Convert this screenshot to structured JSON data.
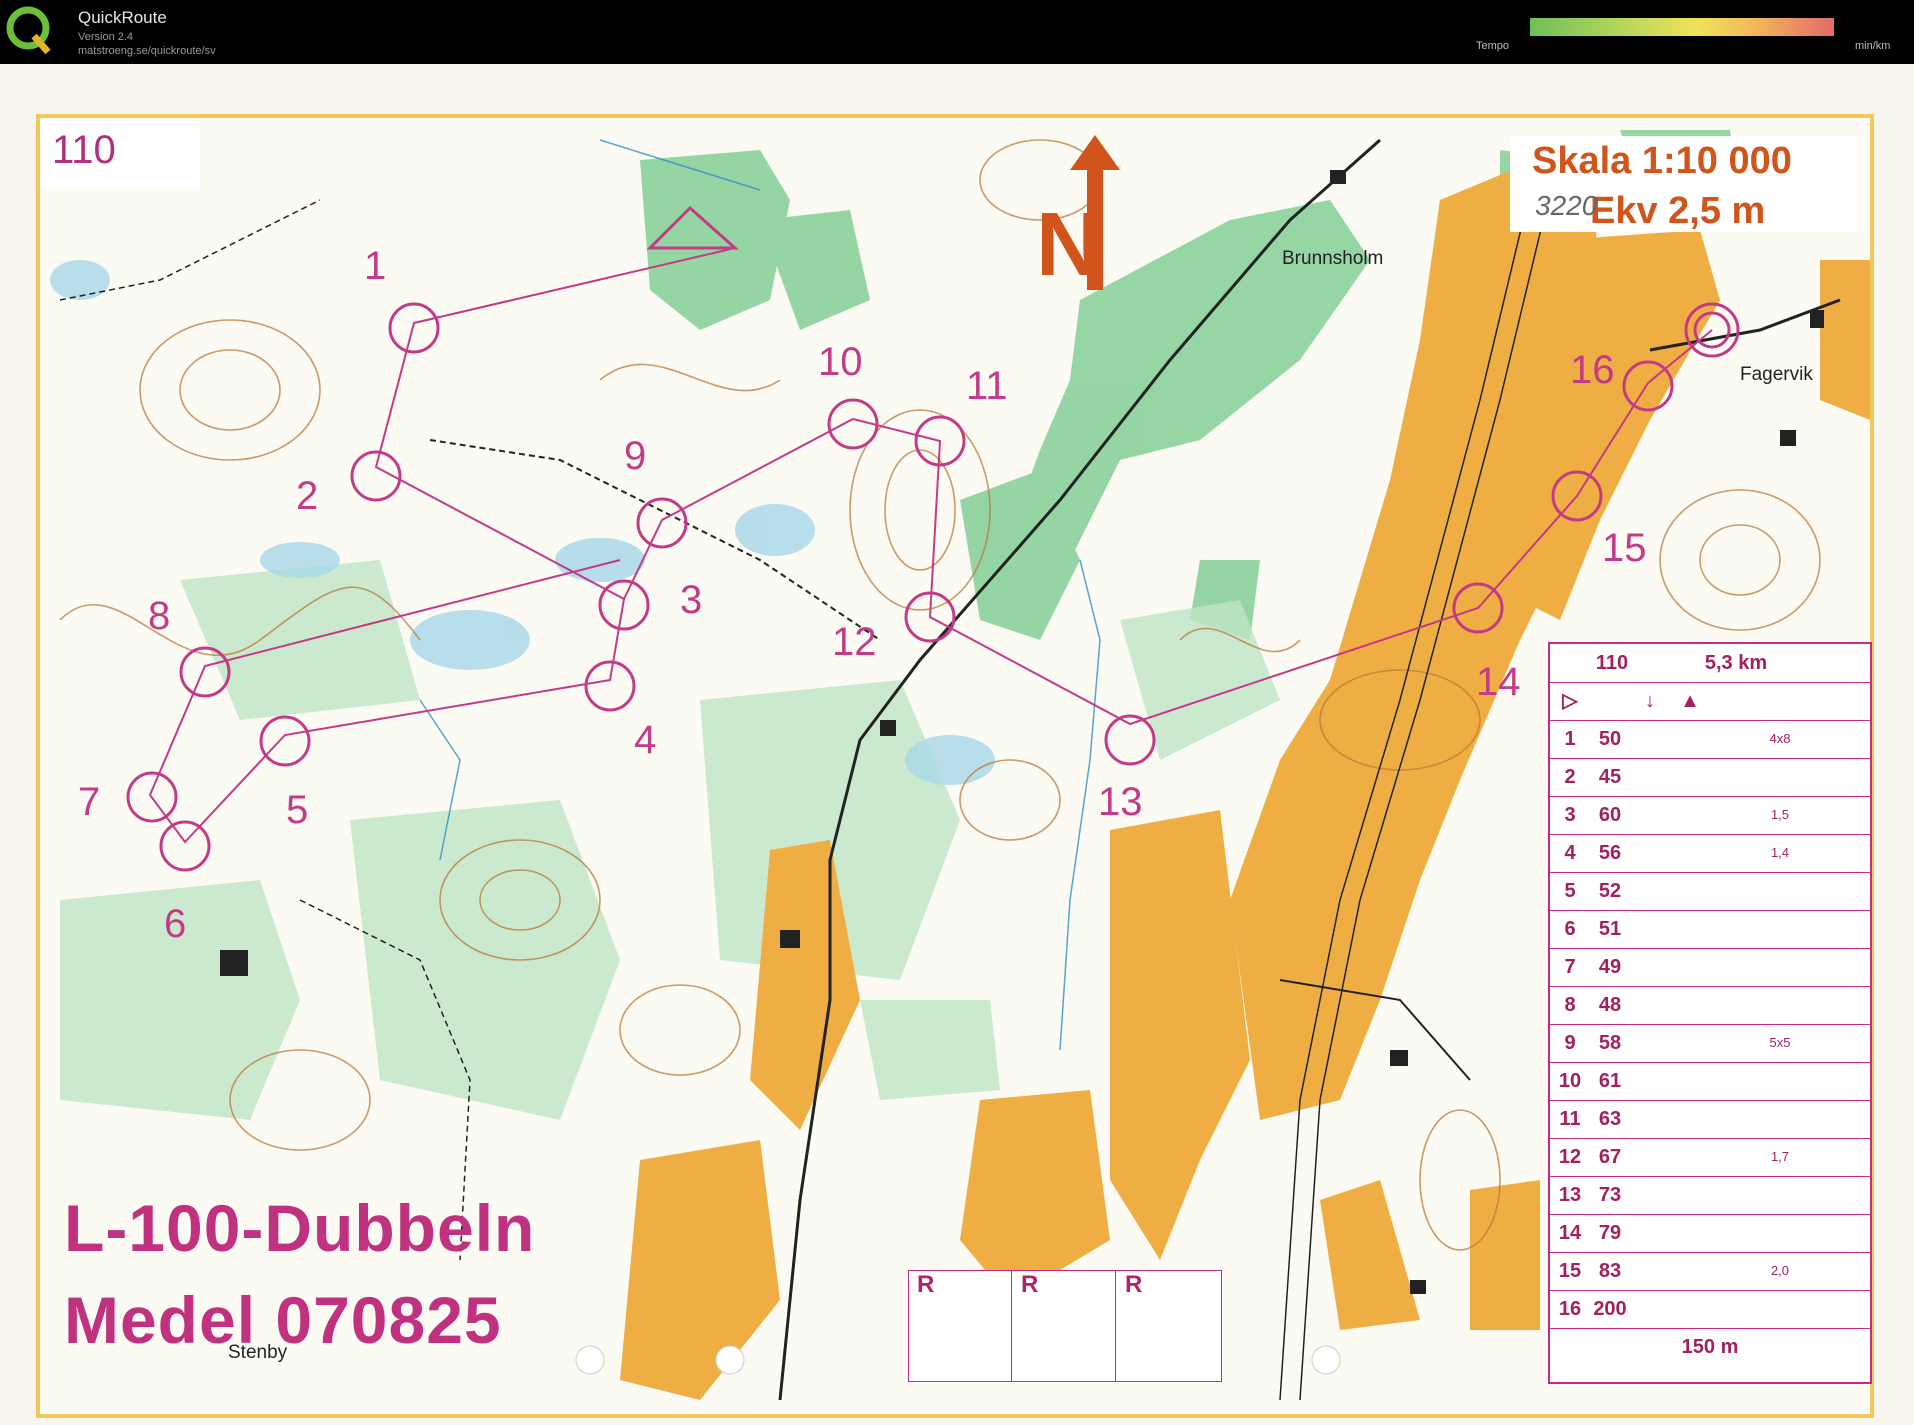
{
  "app": {
    "name": "QuickRoute",
    "version": "Version 2.4",
    "url": "matstroeng.se/quickroute/sv",
    "tempo_label": "Tempo",
    "tempo_unit": "min/km"
  },
  "map": {
    "course_number": "110",
    "scale_text": "Skala 1:10 000",
    "contour_text": "Ekv 2,5 m",
    "handwriting": "3220",
    "place_names": [
      "Brunnsholm",
      "Fagervik",
      "Stenby"
    ],
    "event_title": "L-100-Dubbeln",
    "event_subtitle": "Medel 070825",
    "north_letter": "N",
    "control_labels": [
      "1",
      "2",
      "3",
      "4",
      "5",
      "6",
      "7",
      "8",
      "9",
      "10",
      "11",
      "12",
      "13",
      "14",
      "15",
      "16"
    ],
    "colors": {
      "course": "#c33a86",
      "open_land": "#f0b24a",
      "forest_green": "#7ec88f",
      "contours": "#b97a3a"
    }
  },
  "description_table": {
    "header_course": "110",
    "header_length": "5,3 km",
    "rows": [
      {
        "num": "1",
        "code": "50",
        "extra": "4x8"
      },
      {
        "num": "2",
        "code": "45",
        "extra": ""
      },
      {
        "num": "3",
        "code": "60",
        "extra": "1,5"
      },
      {
        "num": "4",
        "code": "56",
        "extra": "1,4"
      },
      {
        "num": "5",
        "code": "52",
        "extra": ""
      },
      {
        "num": "6",
        "code": "51",
        "extra": ""
      },
      {
        "num": "7",
        "code": "49",
        "extra": ""
      },
      {
        "num": "8",
        "code": "48",
        "extra": ""
      },
      {
        "num": "9",
        "code": "58",
        "extra": "5x5"
      },
      {
        "num": "10",
        "code": "61",
        "extra": ""
      },
      {
        "num": "11",
        "code": "63",
        "extra": ""
      },
      {
        "num": "12",
        "code": "67",
        "extra": "1,7"
      },
      {
        "num": "13",
        "code": "73",
        "extra": ""
      },
      {
        "num": "14",
        "code": "79",
        "extra": ""
      },
      {
        "num": "15",
        "code": "83",
        "extra": "2,0"
      },
      {
        "num": "16",
        "code": "200",
        "extra": ""
      }
    ],
    "finish_distance": "150 m"
  },
  "r_boxes": [
    "R",
    "R",
    "R"
  ]
}
